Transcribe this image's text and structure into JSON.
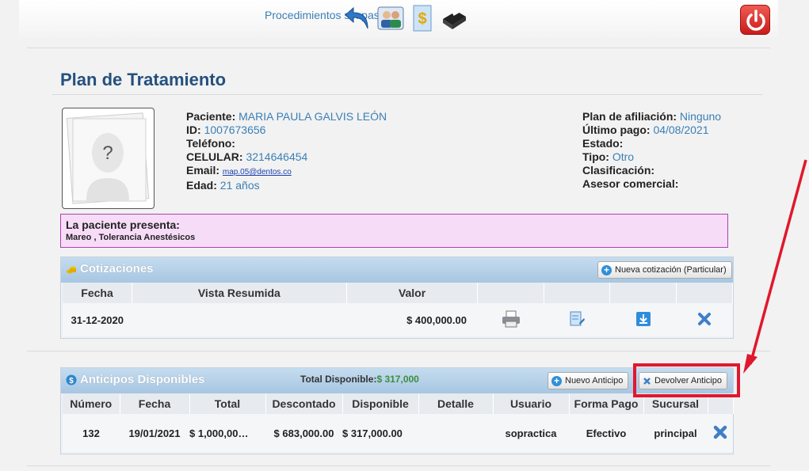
{
  "header": {
    "link_label": "Procedimientos sin pasar",
    "icons": [
      "return-arrow-icon",
      "users-icon",
      "money-document-icon",
      "pos-terminal-icon",
      "power-icon"
    ]
  },
  "page": {
    "title": "Plan de Tratamiento"
  },
  "patient": {
    "photo_placeholder": "?",
    "left": [
      {
        "label": "Paciente:",
        "value": "MARIA PAULA GALVIS LEÓN"
      },
      {
        "label": "ID:",
        "value": "1007673656"
      },
      {
        "label": "Teléfono:",
        "value": ""
      },
      {
        "label": "CELULAR:",
        "value": "3214646454"
      },
      {
        "label": "Email:",
        "value": "map.05@dentos.co"
      },
      {
        "label": "Edad:",
        "value": "21 años"
      }
    ],
    "right": [
      {
        "label": "Plan de afiliación:",
        "value": "Ninguno"
      },
      {
        "label": "Último pago:",
        "value": "04/08/2021"
      },
      {
        "label": "Estado:",
        "value": ""
      },
      {
        "label": "Tipo:",
        "value": "Otro"
      },
      {
        "label": "Clasificación:",
        "value": ""
      },
      {
        "label": "Asesor comercial:",
        "value": ""
      }
    ]
  },
  "alert": {
    "title": "La paciente presenta:",
    "detail": "Mareo , Tolerancia Anestésicos"
  },
  "cotizaciones": {
    "title": "Cotizaciones",
    "new_button": "Nueva cotización (Particular)",
    "columns": [
      "Fecha",
      "Vista Resumida",
      "Valor",
      "",
      "",
      "",
      ""
    ],
    "rows": [
      {
        "fecha": "31-12-2020",
        "vista": "",
        "valor": "$ 400,000.00"
      }
    ]
  },
  "anticipos": {
    "title": "Anticipos Disponibles",
    "total_label": "Total Disponible:",
    "total_value": "$ 317,000",
    "new_button": "Nuevo Anticipo",
    "return_button": "Devolver Anticipo",
    "columns": [
      "Número",
      "Fecha",
      "Total",
      "Descontado",
      "Disponible",
      "Detalle",
      "Usuario",
      "Forma Pago",
      "Sucursal",
      ""
    ],
    "rows": [
      {
        "numero": "132",
        "fecha": "19/01/2021",
        "total": "$ 1,000,00…",
        "descontado": "$ 683,000.00",
        "disponible": "$ 317,000.00",
        "detalle": "",
        "usuario": "sopractica",
        "forma": "Efectivo",
        "sucursal": "principal"
      }
    ]
  },
  "colors": {
    "accent": "#3a7fb5",
    "title": "#25507d",
    "highlight": "#e0182d",
    "alert_bg": "#f7dcf7"
  }
}
